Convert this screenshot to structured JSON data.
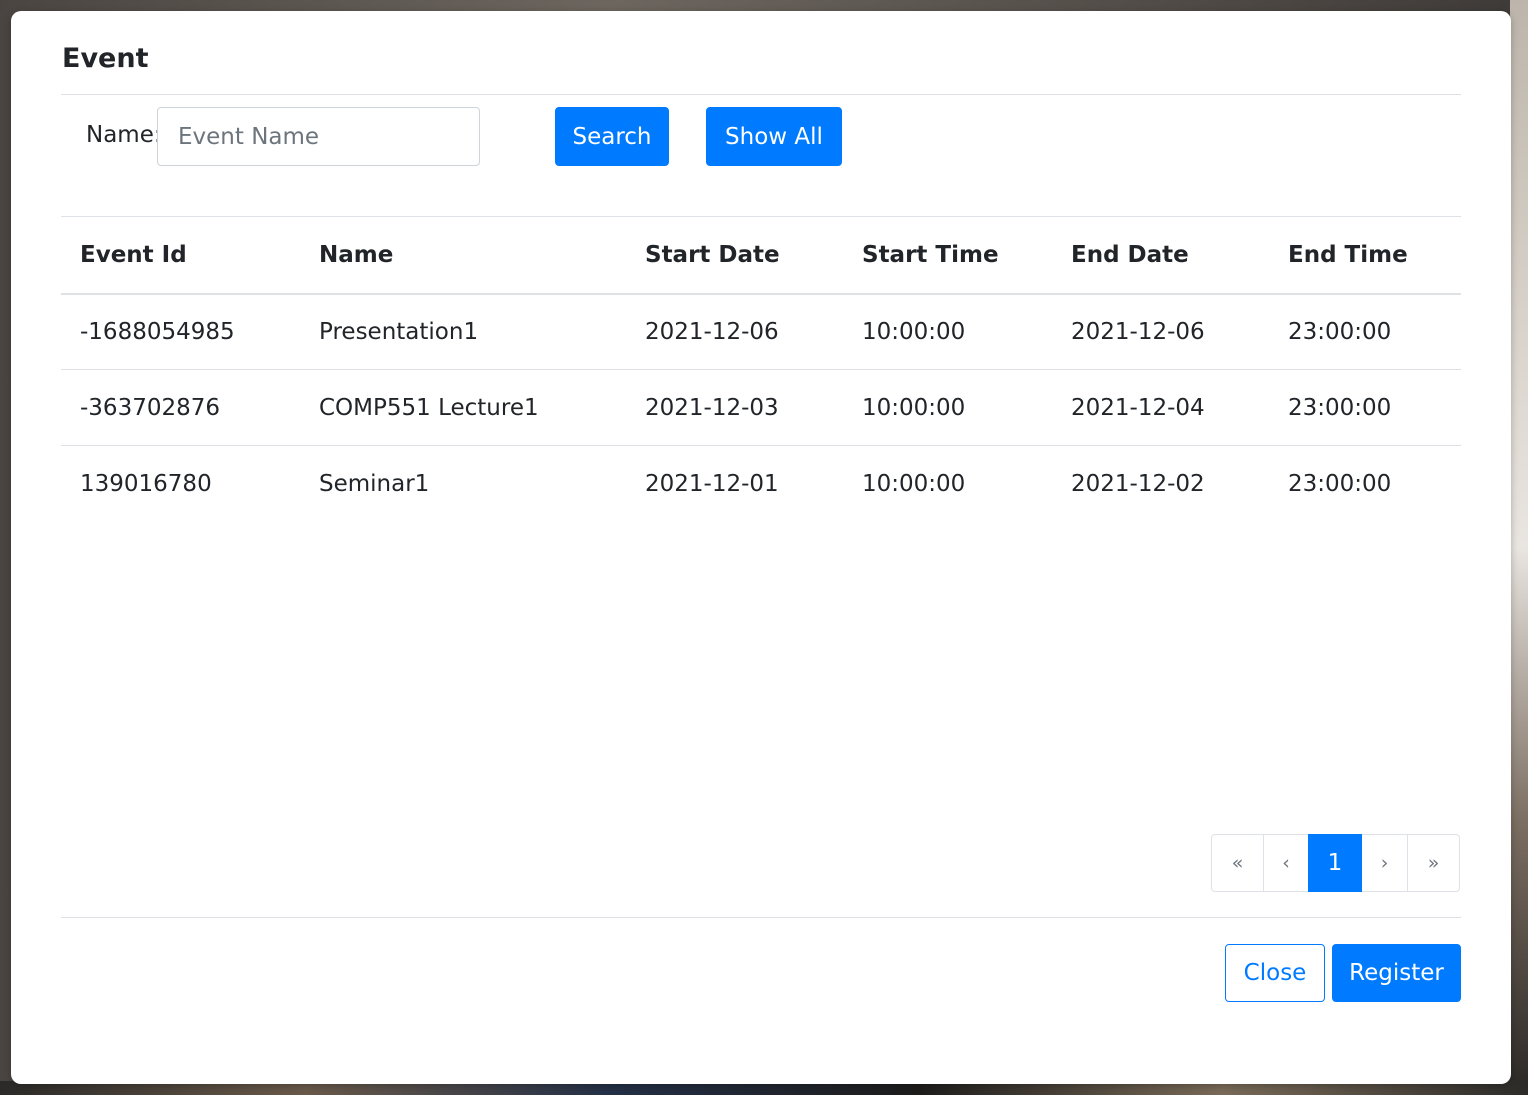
{
  "modal": {
    "title": "Event"
  },
  "search": {
    "name_label": "Name:",
    "name_placeholder": "Event Name",
    "name_value": "",
    "search_label": "Search",
    "show_all_label": "Show All"
  },
  "table": {
    "headers": [
      "Event Id",
      "Name",
      "Start Date",
      "Start Time",
      "End Date",
      "End Time"
    ],
    "rows": [
      [
        "-1688054985",
        "Presentation1",
        "2021-12-06",
        "10:00:00",
        "2021-12-06",
        "23:00:00"
      ],
      [
        "-363702876",
        "COMP551 Lecture1",
        "2021-12-03",
        "10:00:00",
        "2021-12-04",
        "23:00:00"
      ],
      [
        "139016780",
        "Seminar1",
        "2021-12-01",
        "10:00:00",
        "2021-12-02",
        "23:00:00"
      ]
    ]
  },
  "pagination": {
    "first": "«",
    "prev": "‹",
    "current": "1",
    "next": "›",
    "last": "»"
  },
  "footer": {
    "close_label": "Close",
    "register_label": "Register"
  },
  "colors": {
    "primary": "#007bff",
    "border": "#dee2e6",
    "text": "#212529"
  }
}
